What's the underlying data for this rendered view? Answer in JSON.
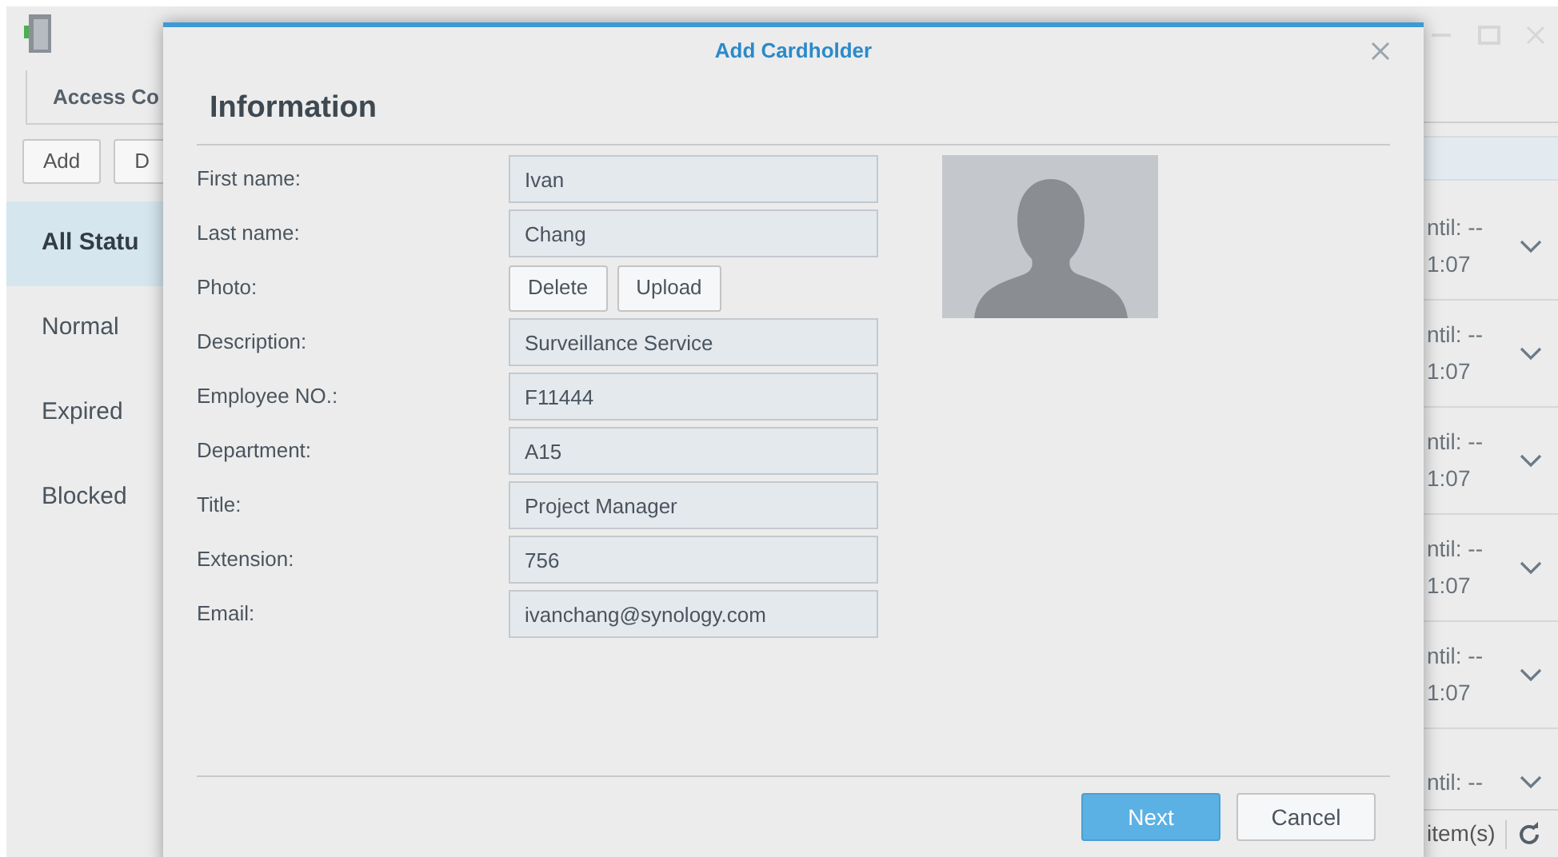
{
  "app": {
    "title": "Access Co",
    "toolbar_buttons": [
      "Add",
      "D"
    ],
    "sidebar": [
      {
        "label": "All Statu",
        "selected": true
      },
      {
        "label": "Normal",
        "selected": false
      },
      {
        "label": "Expired",
        "selected": false
      },
      {
        "label": "Blocked",
        "selected": false
      }
    ],
    "rows": [
      {
        "line_1": "ntil: --",
        "line_2": "1:07"
      },
      {
        "line_1": "ntil: --",
        "line_2": "1:07"
      },
      {
        "line_1": "ntil: --",
        "line_2": "1:07"
      },
      {
        "line_1": "ntil: --",
        "line_2": "1:07"
      },
      {
        "line_1": "ntil: --",
        "line_2": "1:07"
      },
      {
        "line_1": "ntil: --"
      }
    ],
    "status_bar": {
      "count": "item(s)"
    }
  },
  "dialog": {
    "title": "Add Cardholder",
    "section": "Information",
    "fields": [
      {
        "kind": "text",
        "label": "First name:",
        "value": "Ivan"
      },
      {
        "kind": "text",
        "label": "Last name:",
        "value": "Chang"
      },
      {
        "kind": "buttons",
        "label": "Photo:",
        "buttons": [
          "Delete",
          "Upload"
        ]
      },
      {
        "kind": "text",
        "label": "Description:",
        "value": "Surveillance Service"
      },
      {
        "kind": "text",
        "label": "Employee NO.:",
        "value": "F11444"
      },
      {
        "kind": "text",
        "label": "Department:",
        "value": "A15"
      },
      {
        "kind": "text",
        "label": "Title:",
        "value": "Project Manager"
      },
      {
        "kind": "text",
        "label": "Extension:",
        "value": "756"
      },
      {
        "kind": "text",
        "label": "Email:",
        "value": "ivanchang@synology.com"
      }
    ],
    "buttons": [
      {
        "label": "Next",
        "primary": true
      },
      {
        "label": "Cancel",
        "primary": false
      }
    ]
  }
}
